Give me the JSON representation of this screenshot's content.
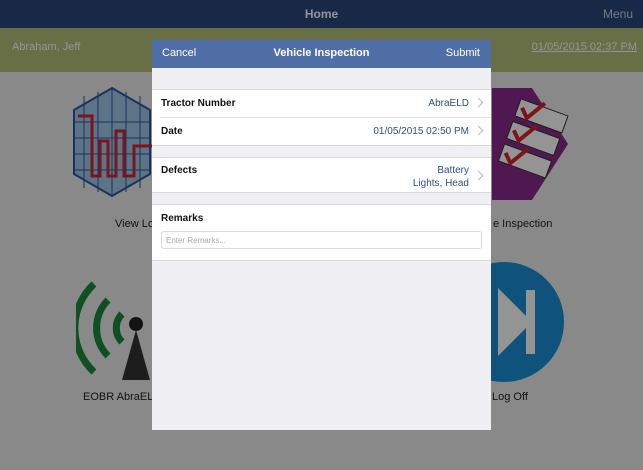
{
  "topbar": {
    "title": "Home",
    "menu_label": "Menu"
  },
  "infobar": {
    "driver_name": "Abraham, Jeff",
    "datetime": "01/05/2015 02:37 PM"
  },
  "tiles": {
    "view_logs": "View Lo",
    "vehicle_inspection": "e Inspection",
    "eobr": "EOBR AbraEL",
    "log_off": "Log Off"
  },
  "modal": {
    "cancel_label": "Cancel",
    "title": "Vehicle Inspection",
    "submit_label": "Submit",
    "tractor_label": "Tractor Number",
    "tractor_value": "AbraELD",
    "date_label": "Date",
    "date_value": "01/05/2015 02:50 PM",
    "defects_label": "Defects",
    "defects_value_1": "Battery",
    "defects_value_2": "Lights, Head",
    "remarks_label": "Remarks",
    "remarks_placeholder": "Enter Remarks...",
    "remarks_value": ""
  },
  "colors": {
    "topbar": "#2a477d",
    "infobar": "#b3c07a",
    "modal_header": "#4f6fa6",
    "value_text": "#2f4e86"
  }
}
